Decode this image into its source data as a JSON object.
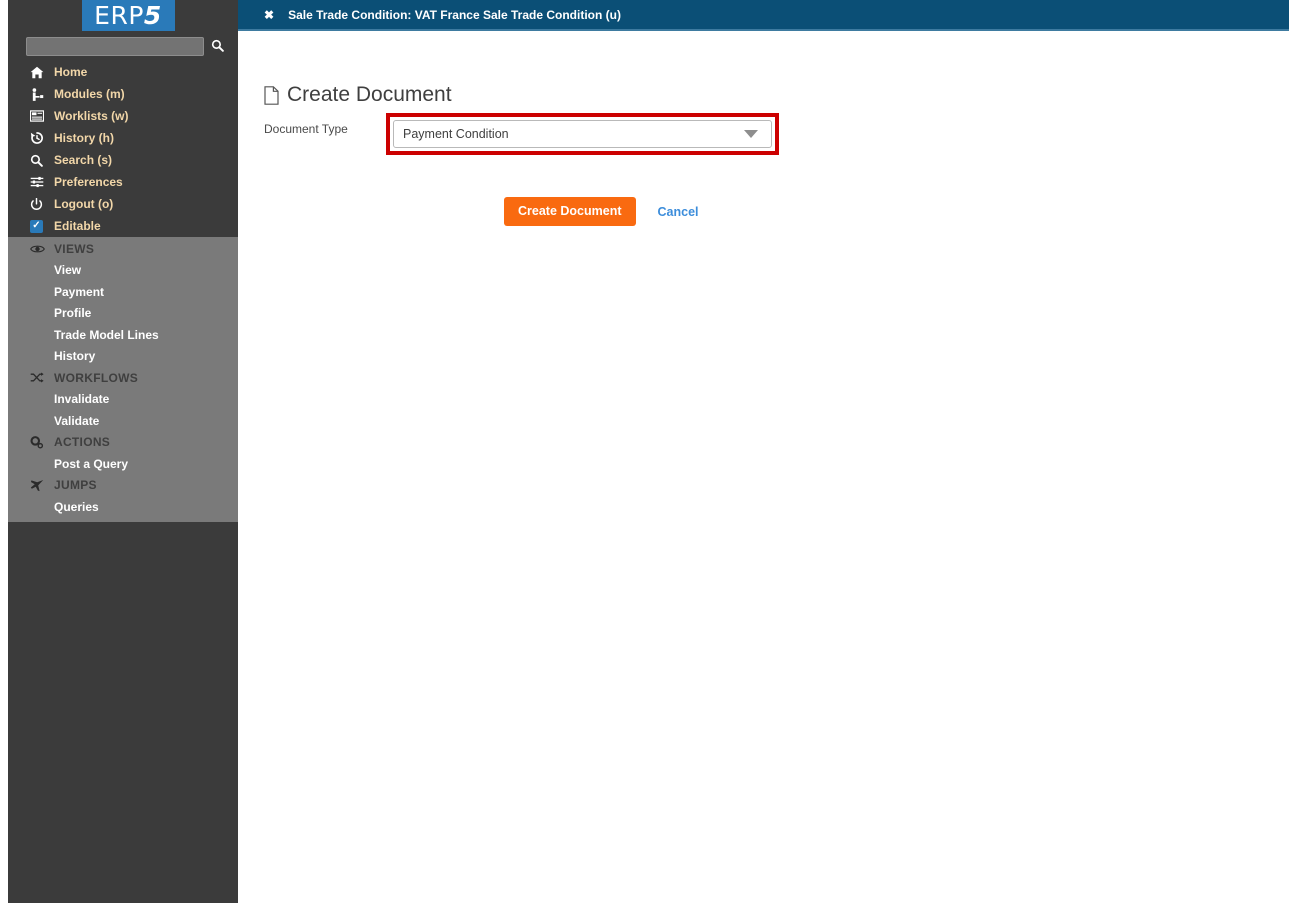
{
  "brand": {
    "logo_primary": "ERP",
    "logo_accent": "5",
    "logo_bg": "#2a7ab9"
  },
  "sidebar": {
    "search": {
      "value": "",
      "placeholder": "",
      "icon": "search-icon"
    },
    "main_items": [
      {
        "label": "Home",
        "icon": "home-icon"
      },
      {
        "label": "Modules (m)",
        "icon": "modules-icon"
      },
      {
        "label": "Worklists (w)",
        "icon": "worklists-icon"
      },
      {
        "label": "History (h)",
        "icon": "history-icon"
      },
      {
        "label": "Search (s)",
        "icon": "search-icon"
      },
      {
        "label": "Preferences",
        "icon": "sliders-icon"
      },
      {
        "label": "Logout (o)",
        "icon": "power-icon"
      },
      {
        "label": "Editable",
        "icon": "checkbox-checked-icon",
        "checked": true
      }
    ],
    "groups": [
      {
        "title": "VIEWS",
        "icon": "eye-icon",
        "items": [
          "View",
          "Payment",
          "Profile",
          "Trade Model Lines",
          "History"
        ]
      },
      {
        "title": "WORKFLOWS",
        "icon": "shuffle-icon",
        "items": [
          "Invalidate",
          "Validate"
        ]
      },
      {
        "title": "ACTIONS",
        "icon": "gears-icon",
        "items": [
          "Post a Query"
        ]
      },
      {
        "title": "JUMPS",
        "icon": "plane-icon",
        "items": [
          "Queries"
        ]
      }
    ]
  },
  "topbar": {
    "close_label": "✖",
    "tab_title": "Sale Trade Condition: VAT France Sale Trade Condition (u)",
    "bg_color": "#0b4f76"
  },
  "main": {
    "heading": "Create Document",
    "heading_icon": "document-icon",
    "form": {
      "document_type_label": "Document Type",
      "document_type_value": "Payment Condition",
      "document_type_options": [
        "Payment Condition"
      ],
      "highlight_color": "#cc0000"
    },
    "create_button": "Create Document",
    "create_button_color": "#f96a10",
    "cancel_link": "Cancel",
    "cancel_link_color": "#3c8ddb"
  }
}
